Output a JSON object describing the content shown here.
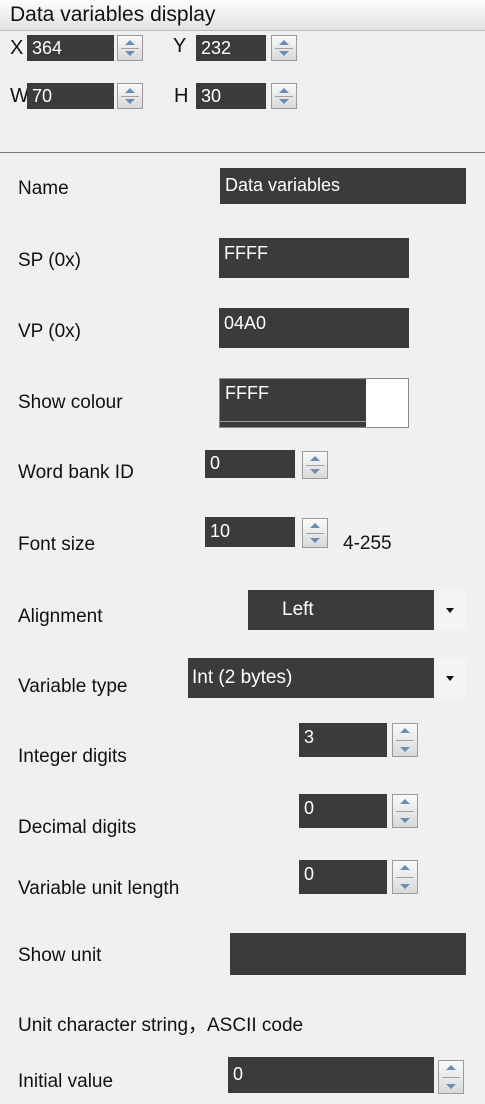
{
  "title": "Data variables display",
  "position": {
    "x_label": "X",
    "x_value": "364",
    "y_label": "Y",
    "y_value": "232",
    "w_label": "W",
    "w_value": "70",
    "h_label": "H",
    "h_value": "30"
  },
  "fields": {
    "name": {
      "label": "Name",
      "value": "Data variables"
    },
    "sp": {
      "label": "SP (0x)",
      "value": "FFFF"
    },
    "vp": {
      "label": "VP (0x)",
      "value": "04A0"
    },
    "show_colour": {
      "label": "Show colour",
      "value": "FFFF",
      "swatch_color": "#ffffff"
    },
    "word_bank_id": {
      "label": "Word bank ID",
      "value": "0"
    },
    "font_size": {
      "label": "Font size",
      "value": "10",
      "range": "4-255"
    },
    "alignment": {
      "label": "Alignment",
      "value": "Left"
    },
    "variable_type": {
      "label": "Variable type",
      "value": "Int (2 bytes)"
    },
    "integer_digits": {
      "label": "Integer digits",
      "value": "3"
    },
    "decimal_digits": {
      "label": "Decimal digits",
      "value": "0"
    },
    "variable_unit_length": {
      "label": "Variable unit length",
      "value": "0"
    },
    "show_unit": {
      "label": "Show unit",
      "value": ""
    },
    "unit_note": "Unit character string，ASCII code",
    "initial_value": {
      "label": "Initial value",
      "value": "0"
    }
  },
  "icons": {
    "spinner": "spinner-updown-icon",
    "dropdown": "dropdown-arrow-icon"
  },
  "colors": {
    "input_background": "#3b3b3b",
    "panel_background": "#f0f0f0",
    "spinner_arrow": "#6a8db3"
  }
}
